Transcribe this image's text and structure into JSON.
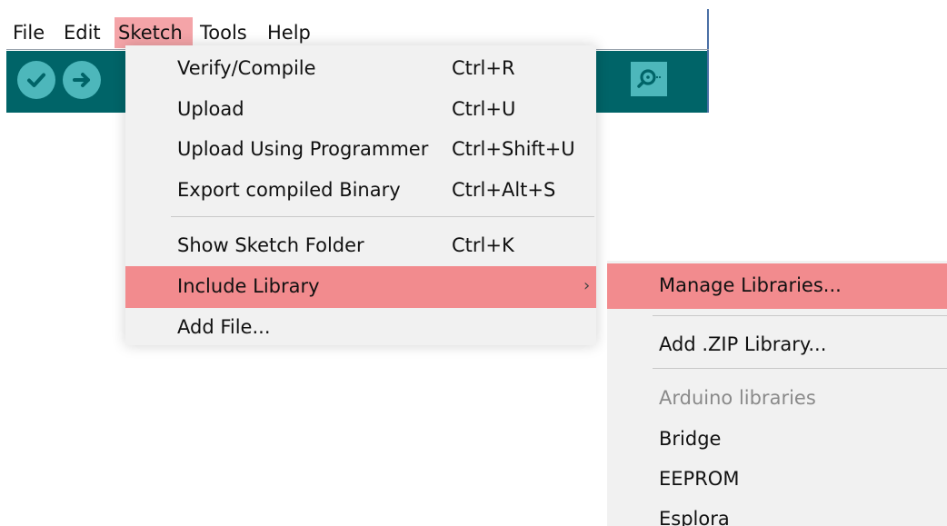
{
  "menubar": {
    "items": [
      {
        "label": "File"
      },
      {
        "label": "Edit"
      },
      {
        "label": "Sketch",
        "active": true
      },
      {
        "label": "Tools"
      },
      {
        "label": "Help"
      }
    ]
  },
  "toolbar": {
    "buttons": [
      {
        "icon": "check-icon",
        "name": "verify"
      },
      {
        "icon": "arrow-right-icon",
        "name": "upload"
      }
    ],
    "serial_monitor_icon": "magnifier-icon",
    "colors": {
      "toolbar_bg": "#006468",
      "button_bg": "#4db7bb"
    }
  },
  "sketch_menu": {
    "items": [
      {
        "label": "Verify/Compile",
        "shortcut": "Ctrl+R"
      },
      {
        "label": "Upload",
        "shortcut": "Ctrl+U"
      },
      {
        "label": "Upload Using Programmer",
        "shortcut": "Ctrl+Shift+U"
      },
      {
        "label": "Export compiled Binary",
        "shortcut": "Ctrl+Alt+S"
      },
      {
        "label": "Show Sketch Folder",
        "shortcut": "Ctrl+K"
      },
      {
        "label": "Include Library",
        "shortcut": "",
        "submenu_arrow": "›",
        "highlighted": true
      },
      {
        "label": "Add File...",
        "shortcut": ""
      }
    ]
  },
  "library_submenu": {
    "items": [
      {
        "label": "Manage Libraries...",
        "highlighted": true
      },
      {
        "label": "Add .ZIP Library..."
      },
      {
        "label": "Arduino libraries",
        "disabled": true
      },
      {
        "label": "Bridge"
      },
      {
        "label": "EEPROM"
      },
      {
        "label": "Esplora"
      }
    ]
  },
  "colors": {
    "highlight": "#f28b8e",
    "active_menu": "#f4a4a8",
    "menu_bg": "#f1f1f1"
  }
}
